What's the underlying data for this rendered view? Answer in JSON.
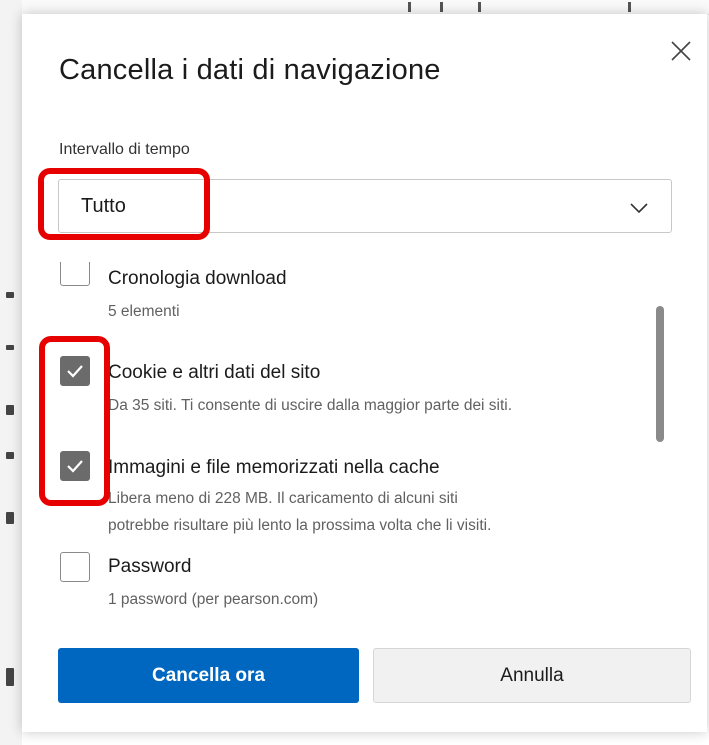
{
  "dialog": {
    "title": "Cancella i dati di navigazione",
    "close_icon": "close-icon"
  },
  "time_range": {
    "label": "Intervallo di tempo",
    "selected": "Tutto",
    "chevron_icon": "chevron-down-icon"
  },
  "items": [
    {
      "label": "Cronologia download",
      "description": "5 elementi",
      "checked": false
    },
    {
      "label": "Cookie e altri dati del sito",
      "description": "Da 35 siti. Ti consente di uscire dalla maggior parte dei siti.",
      "checked": true
    },
    {
      "label": "Immagini e file memorizzati nella cache",
      "description_line1": "Libera meno di 228 MB. Il caricamento di alcuni siti",
      "description_line2": "potrebbe risultare più lento la prossima volta che li visiti.",
      "checked": true
    },
    {
      "label": "Password",
      "description": "1 password (per pearson.com)",
      "checked": false
    }
  ],
  "buttons": {
    "clear_now": "Cancella ora",
    "cancel": "Annulla"
  },
  "colors": {
    "primary": "#0067c0",
    "checkbox_checked": "#6b6b6b",
    "annotation": "#e60000"
  }
}
